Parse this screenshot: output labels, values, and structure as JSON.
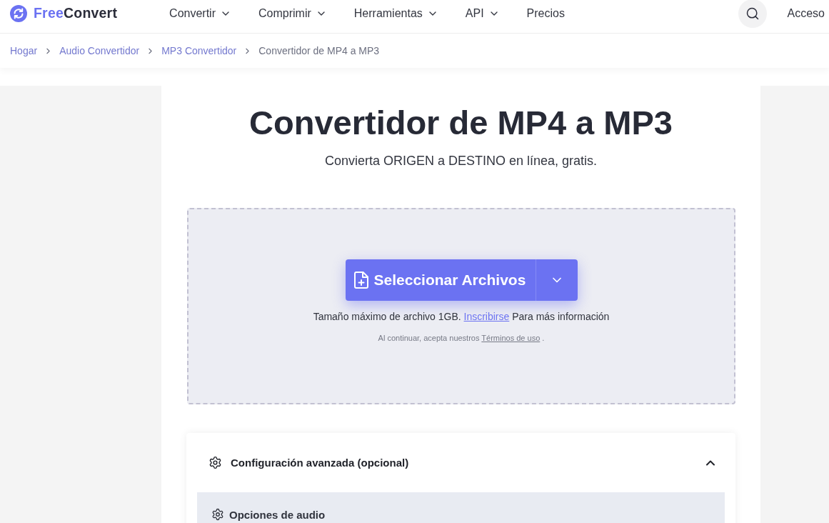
{
  "header": {
    "logo": {
      "first": "Free",
      "second": "Convert"
    },
    "nav": [
      {
        "label": "Convertir",
        "has_menu": true
      },
      {
        "label": "Comprimir",
        "has_menu": true
      },
      {
        "label": "Herramientas",
        "has_menu": true
      },
      {
        "label": "API",
        "has_menu": true
      },
      {
        "label": "Precios",
        "has_menu": false
      }
    ],
    "login": "Acceso"
  },
  "breadcrumb": [
    {
      "label": "Hogar",
      "current": false
    },
    {
      "label": "Audio Convertidor",
      "current": false
    },
    {
      "label": "MP3 Convertidor",
      "current": false
    },
    {
      "label": "Convertidor de MP4 a MP3",
      "current": true
    }
  ],
  "hero": {
    "title": "Convertidor de MP4 a MP3",
    "subtitle": "Convierta ORIGEN a DESTINO en línea, gratis."
  },
  "upload": {
    "button": "Seleccionar Archivos",
    "size_note": {
      "before": "Tamaño máximo de archivo 1GB.",
      "link": "Inscribirse",
      "after": "Para más información"
    },
    "terms": {
      "before": "Al continuar, acepta nuestros",
      "link": "Términos de uso",
      "after": "."
    }
  },
  "advanced": {
    "title": "Configuración avanzada (opcional)",
    "expanded": true,
    "sections": [
      {
        "title": "Opciones de audio"
      }
    ]
  }
}
